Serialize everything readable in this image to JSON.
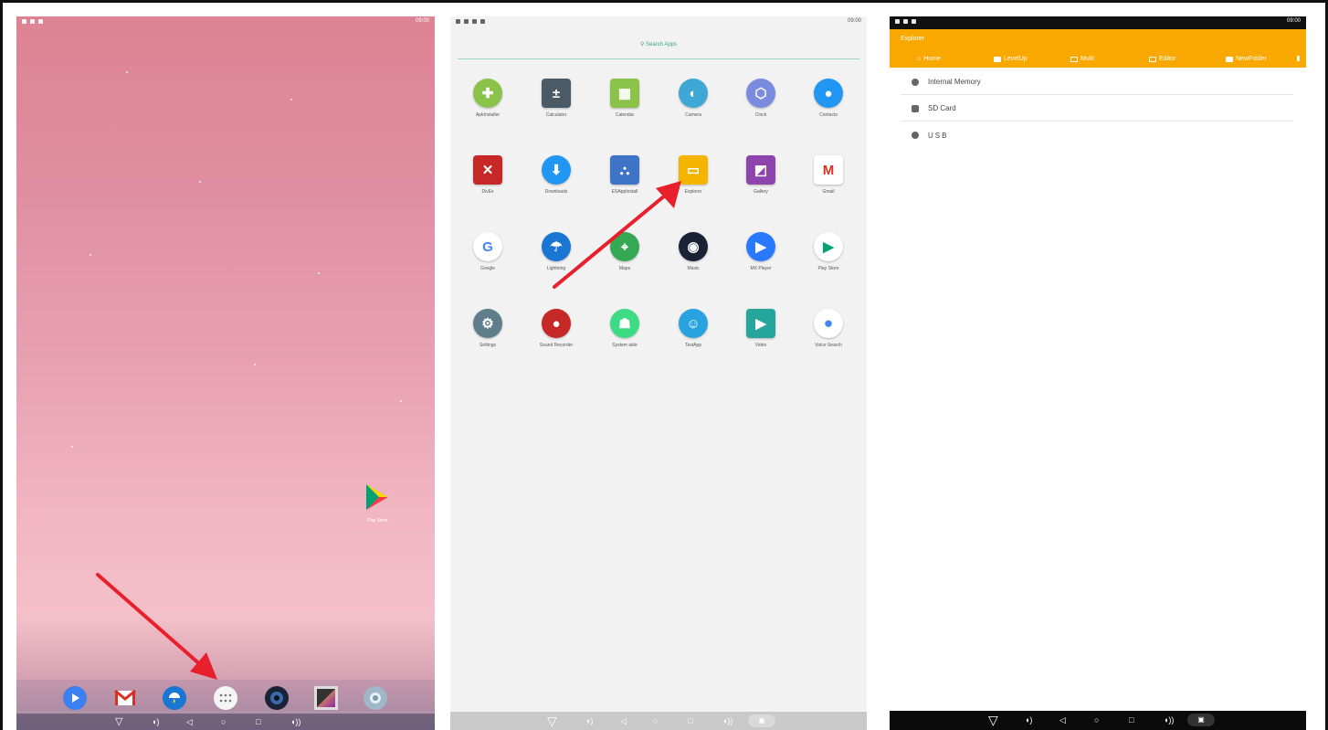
{
  "home": {
    "status_time": "09:00",
    "play_store_label": "Play Store",
    "dock_icons": [
      "play-circle-icon",
      "gmail-icon",
      "lightning-umbrella-icon",
      "all-apps-icon",
      "music-speaker-icon",
      "gallery-icon",
      "camera-lens-icon"
    ],
    "nav_icons": [
      "volume-down-icon",
      "back-icon",
      "home-icon",
      "recents-icon",
      "volume-up-icon"
    ]
  },
  "drawer": {
    "status_time": "09:00",
    "search_placeholder": "Search Apps",
    "apps": [
      {
        "label": "ApkInstaller",
        "icon": "apk-installer-icon",
        "color": "#8bc34a"
      },
      {
        "label": "Calculator",
        "icon": "calculator-icon",
        "color": "#4a5a66"
      },
      {
        "label": "Calendar",
        "icon": "calendar-icon",
        "color": "#8bc34a"
      },
      {
        "label": "Camera",
        "icon": "camera-icon",
        "color": "#3ea7d6"
      },
      {
        "label": "Clock",
        "icon": "clock-icon",
        "color": "#7a8be0"
      },
      {
        "label": "Contacts",
        "icon": "contacts-icon",
        "color": "#2196f3"
      },
      {
        "label": "DivEx",
        "icon": "divex-icon",
        "color": "#c62828"
      },
      {
        "label": "Downloads",
        "icon": "downloads-icon",
        "color": "#2196f3"
      },
      {
        "label": "ESAppInstall",
        "icon": "es-app-install-icon",
        "color": "#3e73c8"
      },
      {
        "label": "Explorer",
        "icon": "explorer-icon",
        "color": "#f5b400"
      },
      {
        "label": "Gallery",
        "icon": "gallery-icon",
        "color": "#8e44ad"
      },
      {
        "label": "Gmail",
        "icon": "gmail-icon",
        "color": "#d93025"
      },
      {
        "label": "Google",
        "icon": "google-icon",
        "color": "#4285f4"
      },
      {
        "label": "Lightning",
        "icon": "lightning-icon",
        "color": "#1976d2"
      },
      {
        "label": "Maps",
        "icon": "maps-icon",
        "color": "#34a853"
      },
      {
        "label": "Music",
        "icon": "music-icon",
        "color": "#1a2335"
      },
      {
        "label": "MX Player",
        "icon": "mx-player-icon",
        "color": "#2979ff"
      },
      {
        "label": "Play Store",
        "icon": "play-store-icon",
        "color": "#00a173"
      },
      {
        "label": "Settings",
        "icon": "settings-icon",
        "color": "#607d8b"
      },
      {
        "label": "Sound Recorder",
        "icon": "sound-recorder-icon",
        "color": "#c62828"
      },
      {
        "label": "System aide",
        "icon": "system-aide-icon",
        "color": "#3ddc84"
      },
      {
        "label": "TestApp",
        "icon": "test-app-icon",
        "color": "#29a3e0"
      },
      {
        "label": "Video",
        "icon": "video-icon",
        "color": "#26a69a"
      },
      {
        "label": "Voice Search",
        "icon": "voice-search-icon",
        "color": "#4285f4"
      }
    ]
  },
  "explorer": {
    "status_time": "09:00",
    "title": "Explorer",
    "toolbar": [
      "Home",
      "LevelUp",
      "Multi",
      "Editor",
      "NewFolder"
    ],
    "storage": [
      "Internal Memory",
      "SD Card",
      "USB"
    ],
    "accent": "#f9a800"
  }
}
